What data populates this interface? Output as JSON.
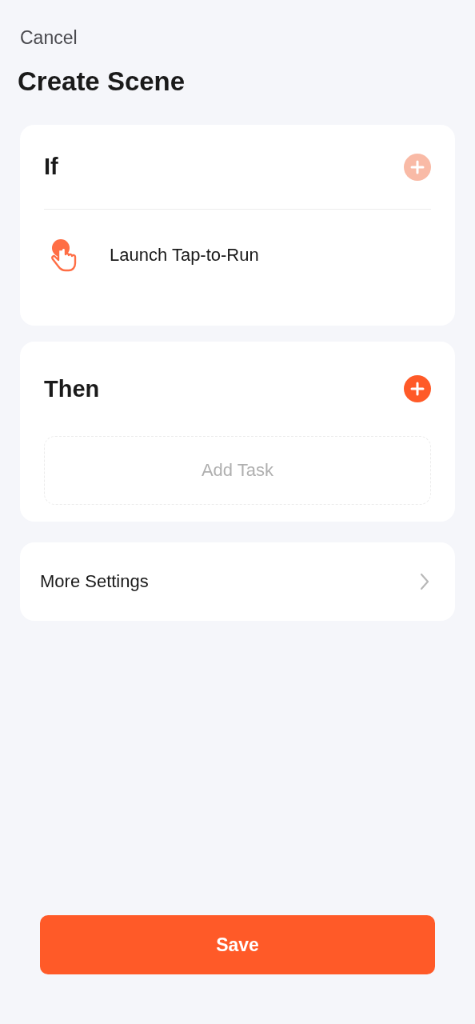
{
  "header": {
    "cancel": "Cancel",
    "title": "Create Scene"
  },
  "if_section": {
    "title": "If",
    "add_disabled": true,
    "conditions": [
      {
        "label": "Launch Tap-to-Run"
      }
    ]
  },
  "then_section": {
    "title": "Then",
    "add_disabled": false,
    "add_task": "Add Task"
  },
  "more_settings": {
    "label": "More Settings"
  },
  "save_button": "Save"
}
